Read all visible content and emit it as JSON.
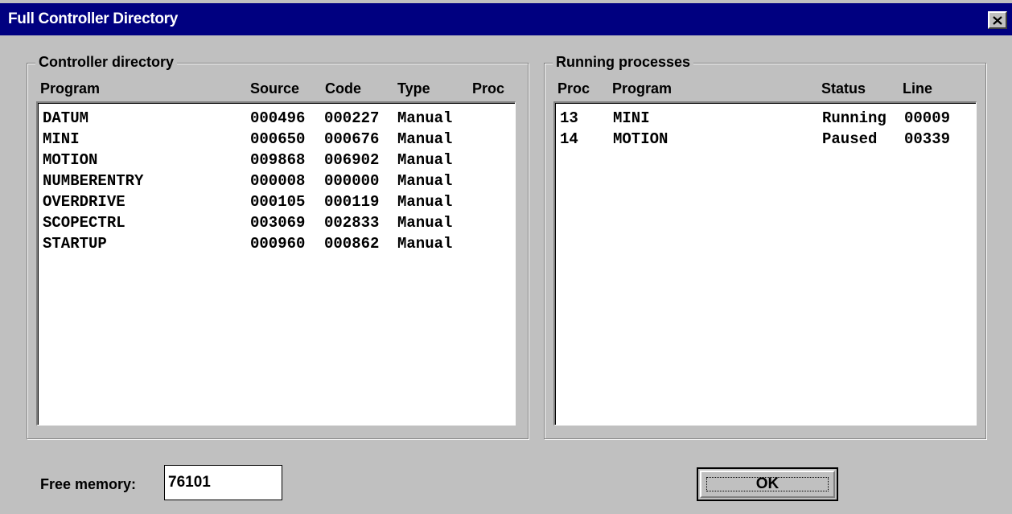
{
  "window": {
    "title": "Full Controller Directory",
    "close_icon": "close-icon"
  },
  "controller_directory": {
    "legend": "Controller directory",
    "headers": {
      "program": "Program",
      "source": "Source",
      "code": "Code",
      "type": "Type",
      "proc": "Proc"
    },
    "rows": [
      {
        "program": "DATUM",
        "source": "000496",
        "code": "000227",
        "type": "Manual",
        "proc": ""
      },
      {
        "program": "MINI",
        "source": "000650",
        "code": "000676",
        "type": "Manual",
        "proc": ""
      },
      {
        "program": "MOTION",
        "source": "009868",
        "code": "006902",
        "type": "Manual",
        "proc": ""
      },
      {
        "program": "NUMBERENTRY",
        "source": "000008",
        "code": "000000",
        "type": "Manual",
        "proc": ""
      },
      {
        "program": "OVERDRIVE",
        "source": "000105",
        "code": "000119",
        "type": "Manual",
        "proc": ""
      },
      {
        "program": "SCOPECTRL",
        "source": "003069",
        "code": "002833",
        "type": "Manual",
        "proc": ""
      },
      {
        "program": "STARTUP",
        "source": "000960",
        "code": "000862",
        "type": "Manual",
        "proc": ""
      }
    ]
  },
  "running_processes": {
    "legend": "Running processes",
    "headers": {
      "proc": "Proc",
      "program": "Program",
      "status": "Status",
      "line": "Line"
    },
    "rows": [
      {
        "proc": "13",
        "program": "MINI",
        "status": "Running",
        "line": "00009"
      },
      {
        "proc": "14",
        "program": "MOTION",
        "status": "Paused",
        "line": "00339"
      }
    ]
  },
  "free_memory": {
    "label": "Free memory:",
    "value": "76101"
  },
  "ok_button": {
    "label": "OK"
  }
}
